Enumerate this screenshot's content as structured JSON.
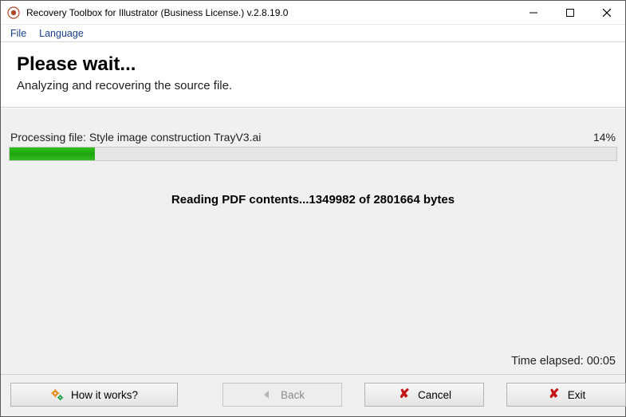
{
  "window": {
    "title": "Recovery Toolbox for Illustrator (Business License.) v.2.8.19.0"
  },
  "menu": {
    "file": "File",
    "language": "Language"
  },
  "header": {
    "title": "Please wait...",
    "subtitle": "Analyzing and recovering the source file."
  },
  "progress": {
    "label_prefix": "Processing file: ",
    "filename": "Style image construction TrayV3.ai",
    "percent_text": "14%",
    "percent_value": 14,
    "status": "Reading PDF contents...1349982 of 2801664 bytes",
    "elapsed_label": "Time elapsed: ",
    "elapsed_value": "00:05"
  },
  "buttons": {
    "how": "How it works?",
    "back": "Back",
    "cancel": "Cancel",
    "exit": "Exit"
  }
}
